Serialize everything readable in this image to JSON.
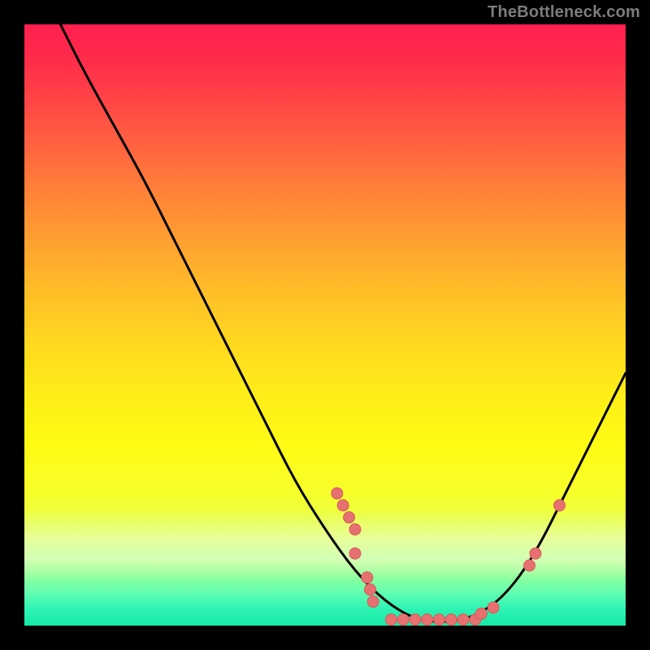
{
  "attribution": "TheBottleneck.com",
  "colors": {
    "frame": "#000000",
    "attribution_text": "#7c7c7c",
    "curve": "#000000",
    "marker_fill": "#e77070",
    "marker_stroke": "#d85a5a"
  },
  "chart_data": {
    "type": "line",
    "title": "",
    "xlabel": "",
    "ylabel": "",
    "xlim": [
      0,
      100
    ],
    "ylim": [
      0,
      100
    ],
    "curve": [
      {
        "x": 6,
        "y": 100
      },
      {
        "x": 10,
        "y": 92
      },
      {
        "x": 15,
        "y": 83
      },
      {
        "x": 20,
        "y": 74
      },
      {
        "x": 25,
        "y": 64
      },
      {
        "x": 30,
        "y": 54
      },
      {
        "x": 35,
        "y": 44
      },
      {
        "x": 40,
        "y": 34
      },
      {
        "x": 45,
        "y": 24
      },
      {
        "x": 50,
        "y": 16
      },
      {
        "x": 55,
        "y": 9
      },
      {
        "x": 60,
        "y": 4
      },
      {
        "x": 65,
        "y": 1
      },
      {
        "x": 70,
        "y": 0.5
      },
      {
        "x": 75,
        "y": 1.5
      },
      {
        "x": 80,
        "y": 5
      },
      {
        "x": 85,
        "y": 12
      },
      {
        "x": 90,
        "y": 22
      },
      {
        "x": 95,
        "y": 32
      },
      {
        "x": 100,
        "y": 42
      }
    ],
    "markers": [
      {
        "x": 52,
        "y": 22
      },
      {
        "x": 53,
        "y": 20
      },
      {
        "x": 54,
        "y": 18
      },
      {
        "x": 55,
        "y": 16
      },
      {
        "x": 55,
        "y": 12
      },
      {
        "x": 57,
        "y": 8
      },
      {
        "x": 57.5,
        "y": 6
      },
      {
        "x": 58,
        "y": 4
      },
      {
        "x": 61,
        "y": 1
      },
      {
        "x": 63,
        "y": 1
      },
      {
        "x": 65,
        "y": 1
      },
      {
        "x": 67,
        "y": 1
      },
      {
        "x": 69,
        "y": 1
      },
      {
        "x": 71,
        "y": 1
      },
      {
        "x": 73,
        "y": 1
      },
      {
        "x": 75,
        "y": 1
      },
      {
        "x": 76,
        "y": 2
      },
      {
        "x": 78,
        "y": 3
      },
      {
        "x": 84,
        "y": 10
      },
      {
        "x": 85,
        "y": 12
      },
      {
        "x": 89,
        "y": 20
      }
    ]
  }
}
